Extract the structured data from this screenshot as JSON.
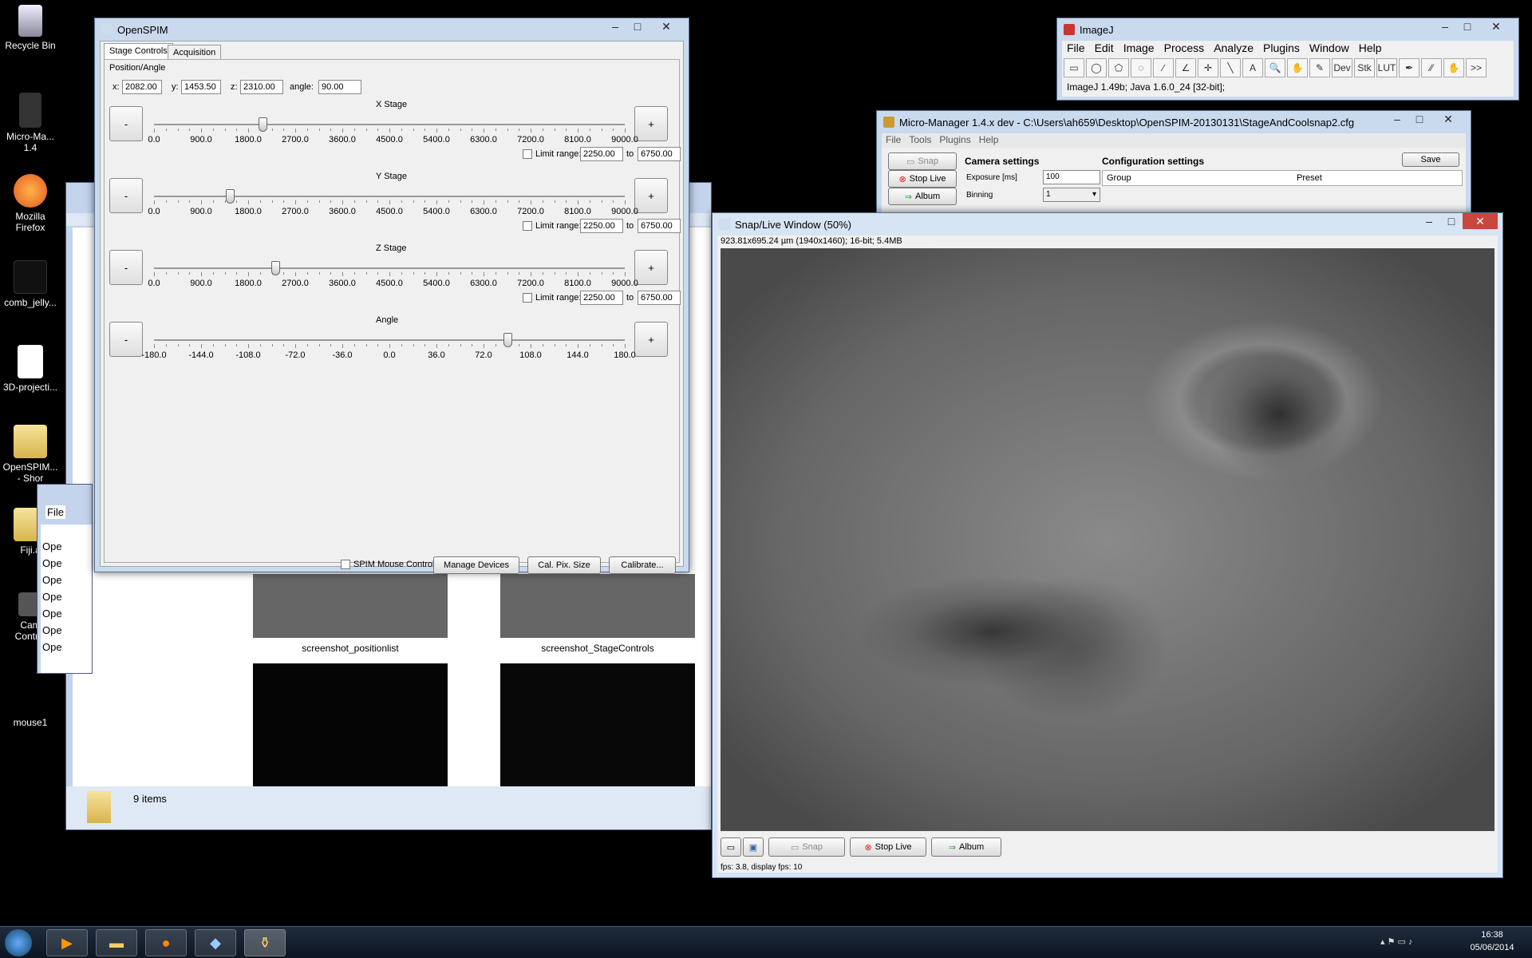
{
  "desktop": {
    "icons": [
      {
        "label": "Recycle Bin"
      },
      {
        "label": "Micro-Ma...\n1.4"
      },
      {
        "label": "Mozilla\nFirefox"
      },
      {
        "label": "comb_jelly..."
      },
      {
        "label": "3D-projecti..."
      },
      {
        "label": "OpenSPIM...\n- Shor"
      },
      {
        "label": "Fiji.a"
      },
      {
        "label": "Cam\nControl"
      },
      {
        "label": "mouse1"
      }
    ]
  },
  "openspim": {
    "title": "OpenSPIM",
    "tabs": [
      "Stage Controls",
      "Acquisition"
    ],
    "group_label": "Position/Angle",
    "x_label": "x:",
    "x_value": "2082.00",
    "y_label": "y:",
    "y_value": "1453.50",
    "z_label": "z:",
    "z_value": "2310.00",
    "angle_label": "angle:",
    "angle_value": "90.00",
    "minus": "-",
    "plus": "+",
    "stages": [
      {
        "name": "X Stage",
        "ticks": [
          "0.0",
          "900.0",
          "1800.0",
          "2700.0",
          "3600.0",
          "4500.0",
          "5400.0",
          "6300.0",
          "7200.0",
          "8100.0",
          "9000.0"
        ],
        "level": 0.231,
        "limit_label": "Limit range:",
        "limit_from": "2250.00",
        "to_label": "to",
        "limit_to": "6750.00"
      },
      {
        "name": "Y Stage",
        "ticks": [
          "0.0",
          "900.0",
          "1800.0",
          "2700.0",
          "3600.0",
          "4500.0",
          "5400.0",
          "6300.0",
          "7200.0",
          "8100.0",
          "9000.0"
        ],
        "level": 0.161,
        "limit_label": "Limit range:",
        "limit_from": "2250.00",
        "to_label": "to",
        "limit_to": "6750.00"
      },
      {
        "name": "Z Stage",
        "ticks": [
          "0.0",
          "900.0",
          "1800.0",
          "2700.0",
          "3600.0",
          "4500.0",
          "5400.0",
          "6300.0",
          "7200.0",
          "8100.0",
          "9000.0"
        ],
        "level": 0.257,
        "limit_label": "Limit range:",
        "limit_from": "2250.00",
        "to_label": "to",
        "limit_to": "6750.00"
      },
      {
        "name": "Angle",
        "ticks": [
          "-180.0",
          "-144.0",
          "-108.0",
          "-72.0",
          "-36.0",
          "0.0",
          "36.0",
          "72.0",
          "108.0",
          "144.0",
          "180.0"
        ],
        "level": 0.75
      }
    ],
    "spim_mouse_controls": "SPIM Mouse Controls",
    "manage_devices": "Manage Devices",
    "cal_pix_size": "Cal. Pix. Size",
    "calibrate": "Calibrate..."
  },
  "imagej": {
    "title": "ImageJ",
    "menu": [
      "File",
      "Edit",
      "Image",
      "Process",
      "Analyze",
      "Plugins",
      "Window",
      "Help"
    ],
    "tools": [
      "▭",
      "◯",
      "⬠",
      "◌",
      "∕",
      "∠",
      "✛",
      "╲",
      "A",
      "🔍",
      "✋",
      "✎",
      "Dev",
      "Stk",
      "LUT",
      "✒",
      "⁄⁄",
      "✋",
      ">>"
    ],
    "status": "ImageJ 1.49b; Java 1.6.0_24 [32-bit];"
  },
  "micromanager": {
    "title": "Micro-Manager 1.4.x dev - C:\\Users\\ah659\\Desktop\\OpenSPIM-20130131\\StageAndCoolsnap2.cfg",
    "menu": [
      "File",
      "Tools",
      "Plugins",
      "Help"
    ],
    "snap": "Snap",
    "stop_live": "Stop Live",
    "album": "Album",
    "camera_settings": "Camera settings",
    "exposure_label": "Exposure [ms]",
    "exposure_value": "100",
    "binning_label": "Binning",
    "binning_value": "1",
    "config_settings": "Configuration settings",
    "save": "Save",
    "group_col": "Group",
    "preset_col": "Preset"
  },
  "snaplive": {
    "title": "Snap/Live Window (50%)",
    "info": "923.81x695.24 µm (1940x1460); 16-bit; 5.4MB",
    "snap": "Snap",
    "stop_live": "Stop Live",
    "album": "Album",
    "fps": "fps: 3.8, display fps: 10"
  },
  "explorer": {
    "thumb1": "screenshot_positionlist",
    "thumb2": "screenshot_StageControls",
    "items": "9 items",
    "ops": [
      "Ope",
      "Ope",
      "Ope",
      "Ope",
      "Ope",
      "Ope",
      "Ope"
    ],
    "file_label": "File"
  },
  "taskbar": {
    "time": "16:38",
    "date": "05/06/2014"
  }
}
